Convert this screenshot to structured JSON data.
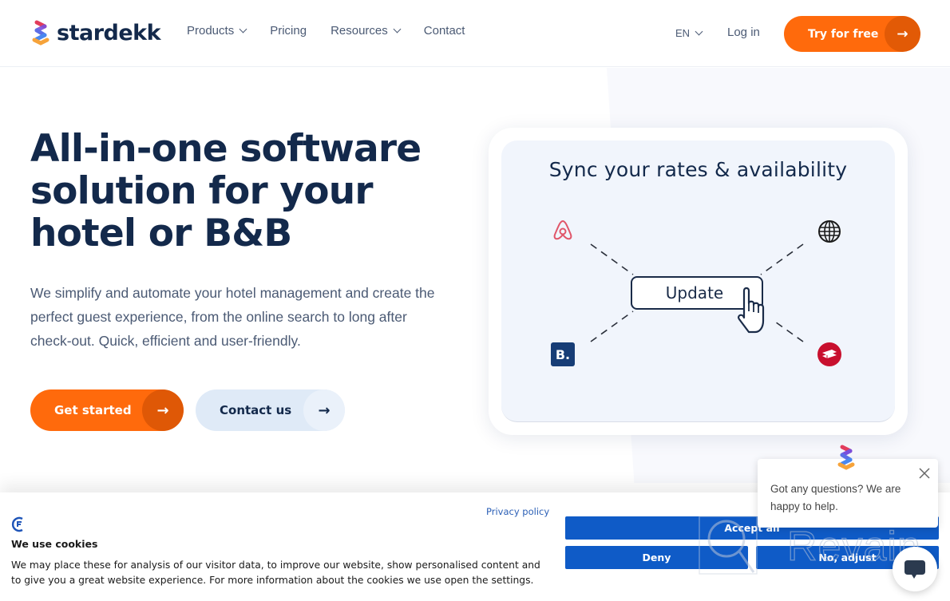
{
  "header": {
    "brand": "stardekk",
    "nav": [
      {
        "label": "Products",
        "has_dropdown": true
      },
      {
        "label": "Pricing",
        "has_dropdown": false
      },
      {
        "label": "Resources",
        "has_dropdown": true
      },
      {
        "label": "Contact",
        "has_dropdown": false
      }
    ],
    "language": "EN",
    "login_label": "Log in",
    "cta_label": "Try for free",
    "cta_icon": "arrow-right-icon"
  },
  "hero": {
    "title": "All-in-one software solution for your hotel or B&B",
    "subtitle": "We simplify and automate your hotel management and create the perfect guest experience, from the online search to long after check-out. Quick, efficient and user-friendly.",
    "primary_button": "Get started",
    "secondary_button": "Contact us"
  },
  "illustration": {
    "title": "Sync your rates & availability",
    "button_label": "Update",
    "channels": [
      "airbnb-icon",
      "globe-icon",
      "booking-icon",
      "hotel-bed-icon"
    ],
    "booking_letter": "B."
  },
  "cookies": {
    "title": "We use cookies",
    "text": "We may place these for analysis of our visitor data, to improve our website, show personalised content and to give you a great website experience. For more information about the cookies we use open the settings.",
    "privacy_link": "Privacy policy",
    "accept_label": "Accept all",
    "deny_label": "Deny",
    "adjust_label": "No, adjust"
  },
  "chat": {
    "message": "Got any questions? We are happy to help."
  },
  "watermark": {
    "text": "Revain"
  },
  "colors": {
    "brand_orange": "#ff6a0c",
    "navy": "#13294b",
    "cookie_blue": "#0f5bc7",
    "airbnb": "#e0566a",
    "booking": "#173d76",
    "hotel_red": "#c8102e"
  }
}
